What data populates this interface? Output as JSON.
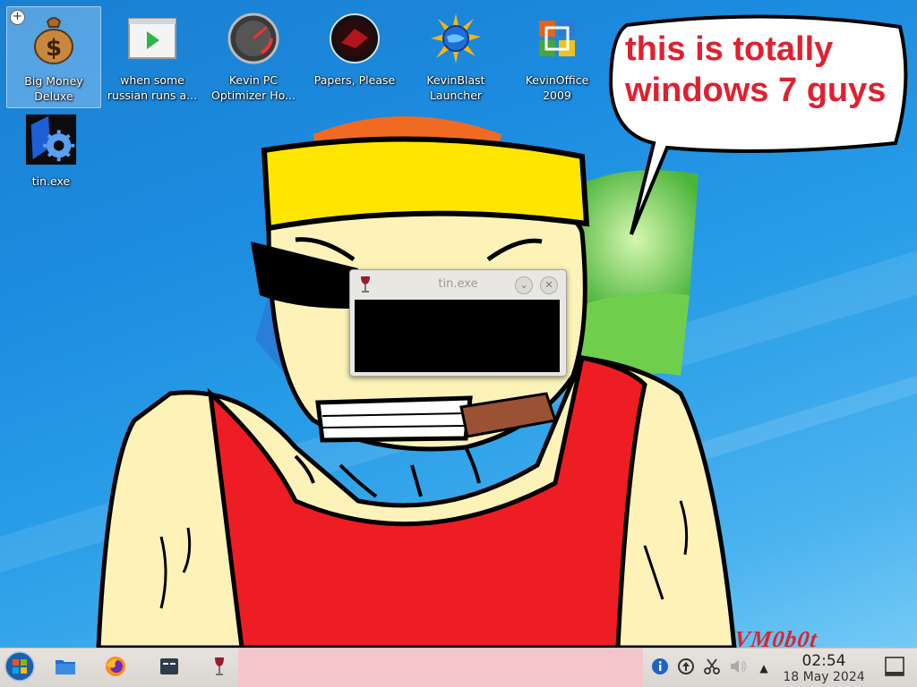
{
  "desktop": {
    "icons": [
      {
        "label": "Big Money\nDeluxe",
        "icon": "money-bag-icon"
      },
      {
        "label": "when some\nrussian runs a...",
        "icon": "video-play-icon"
      },
      {
        "label": "Kevin PC\nOptimizer Ho...",
        "icon": "speedometer-icon"
      },
      {
        "label": "Papers, Please",
        "icon": "papers-please-icon"
      },
      {
        "label": "KevinBlast\nLauncher",
        "icon": "globe-sun-icon"
      },
      {
        "label": "KevinOffice\n2009",
        "icon": "office-icon"
      },
      {
        "label": "tin.exe",
        "icon": "gear-app-icon"
      }
    ],
    "speech_bubble": "this is totally windows 7 guys"
  },
  "dialog": {
    "title": "tin.exe"
  },
  "taskbar": {
    "clock_time": "02:54",
    "clock_date": "18 May 2024",
    "watermark": "VM0b0t"
  },
  "colors": {
    "accent_red": "#e02030",
    "taskbar_bg": "#e6e2dd",
    "task_strip": "#f4c6cc"
  }
}
